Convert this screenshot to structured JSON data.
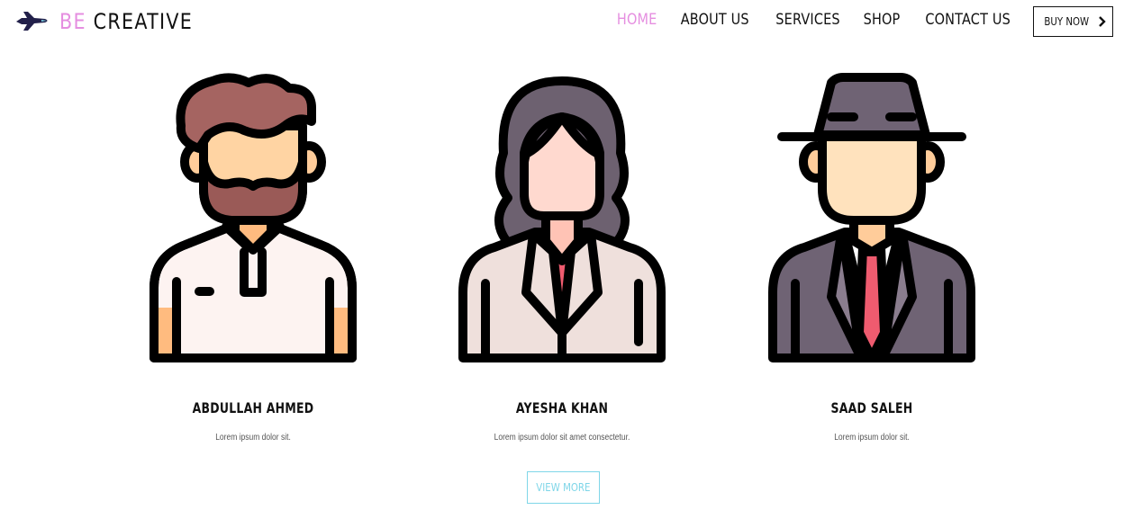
{
  "brand": {
    "prefix": "BE",
    "name": "CREATIVE",
    "icon": "jet-plane-icon"
  },
  "nav": {
    "items": [
      {
        "label": "HOME",
        "active": true
      },
      {
        "label": "ABOUT US",
        "active": false
      },
      {
        "label": "SERVICES",
        "active": false
      },
      {
        "label": "SHOP",
        "active": false
      },
      {
        "label": "CONTACT US",
        "active": false
      }
    ],
    "buy_label": "BUY NOW",
    "buy_icon": "chevron-right-icon"
  },
  "team": [
    {
      "name": "ABDULLAH AHMED",
      "description": "Lorem ipsum dolor sit.",
      "avatar": "bearded-man-avatar"
    },
    {
      "name": "AYESHA KHAN",
      "description": "Lorem ipsum dolor sit amet consectetur.",
      "avatar": "woman-avatar"
    },
    {
      "name": "SAAD SALEH",
      "description": "Lorem ipsum dolor sit.",
      "avatar": "man-in-hat-avatar"
    }
  ],
  "view_more_label": "VIEW MORE",
  "colors": {
    "accent": "#e58ee0",
    "outline": "#7fd6e8",
    "text": "#111111"
  }
}
